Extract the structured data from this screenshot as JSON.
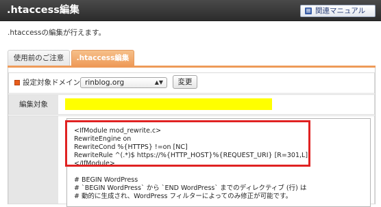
{
  "header": {
    "title": ".htaccess編集",
    "manual_button": "関連マニュアル"
  },
  "description": ".htaccessの編集が行えます。",
  "tabs": [
    {
      "label": "使用前のご注意",
      "active": false
    },
    {
      "label": ".htaccess編集",
      "active": true
    }
  ],
  "domain_row": {
    "label": "設定対象ドメイン",
    "selected_domain": "rinblog.org",
    "change_button": "変更"
  },
  "target_row": {
    "label": "編集対象"
  },
  "editor": {
    "lines": [
      "<IfModule mod_rewrite.c>",
      "RewriteEngine on",
      "RewriteCond %{HTTPS} !=on [NC]",
      "RewriteRule ^(.*)$ https://%{HTTP_HOST}%{REQUEST_URI} [R=301,L]",
      "</IfModule>",
      "",
      "# BEGIN WordPress",
      "# `BEGIN WordPress` から `END WordPress` までのディレクティブ (行) は",
      "# 動的に生成され、WordPress フィルターによってのみ修正が可能です。"
    ]
  },
  "colors": {
    "accent_orange": "#ee9a58",
    "highlight_yellow": "#ffff00",
    "annotation_red": "#e02222",
    "header_dark": "#333333"
  }
}
